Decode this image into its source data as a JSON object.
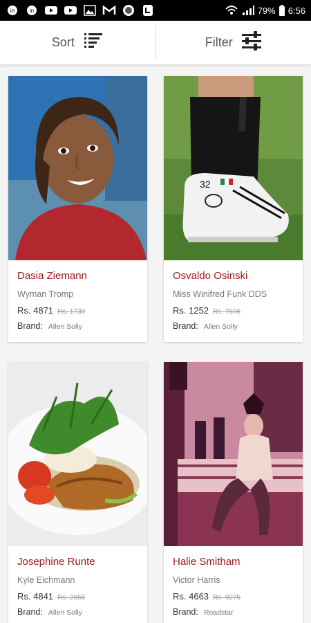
{
  "status_bar": {
    "battery": "79%",
    "time": "6:56"
  },
  "toolbar": {
    "sort_label": "Sort",
    "filter_label": "Filter"
  },
  "products": [
    {
      "name": "Dasia Ziemann",
      "seller": "Wyman Tromp",
      "price": "Rs. 4871",
      "mrp": "Rs. 1730",
      "brand_label": "Brand:",
      "brand": "Allen Solly"
    },
    {
      "name": "Osvaldo Osinski",
      "seller": "Miss Winifred Funk DDS",
      "price": "Rs. 1252",
      "mrp": "Rs. 7606",
      "brand_label": "Brand:",
      "brand": "Allen Solly"
    },
    {
      "name": "Josephine Runte",
      "seller": "Kyle Eichmann",
      "price": "Rs. 4841",
      "mrp": "Rs. 2658",
      "brand_label": "Brand:",
      "brand": "Allen Solly"
    },
    {
      "name": "Halie Smitham",
      "seller": "Victor Harris",
      "price": "Rs. 4663",
      "mrp": "Rs. 9275",
      "brand_label": "Brand:",
      "brand": "Roadstar"
    }
  ],
  "colors": {
    "product_name": "#a01919",
    "status_bar_bg": "#000000"
  }
}
